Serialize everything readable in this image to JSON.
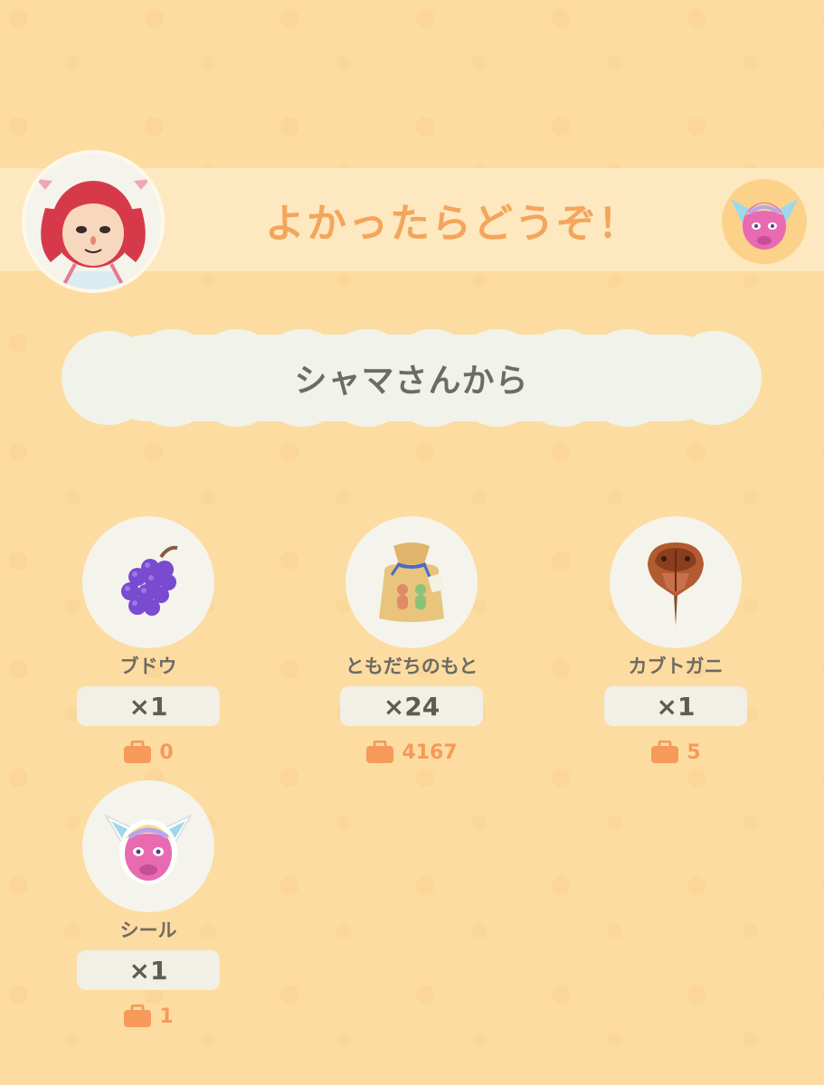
{
  "header": {
    "title": "よかったらどうぞ！"
  },
  "gift_from": {
    "label": "シャマさんから"
  },
  "items": [
    {
      "name": "ブドウ",
      "quantity": "×1",
      "owned": "0",
      "icon": "grapes-icon"
    },
    {
      "name": "ともだちのもと",
      "quantity": "×24",
      "owned": "4167",
      "icon": "friend-powder-bag-icon"
    },
    {
      "name": "カブトガニ",
      "quantity": "×1",
      "owned": "5",
      "icon": "horseshoe-crab-icon"
    },
    {
      "name": "シール",
      "quantity": "×1",
      "owned": "1",
      "icon": "sticker-icon"
    }
  ],
  "colors": {
    "background": "#fcdca0",
    "banner": "#fde8bf",
    "title": "#f4a55c",
    "owned_count": "#f59a5a",
    "text": "#6e6a64"
  }
}
